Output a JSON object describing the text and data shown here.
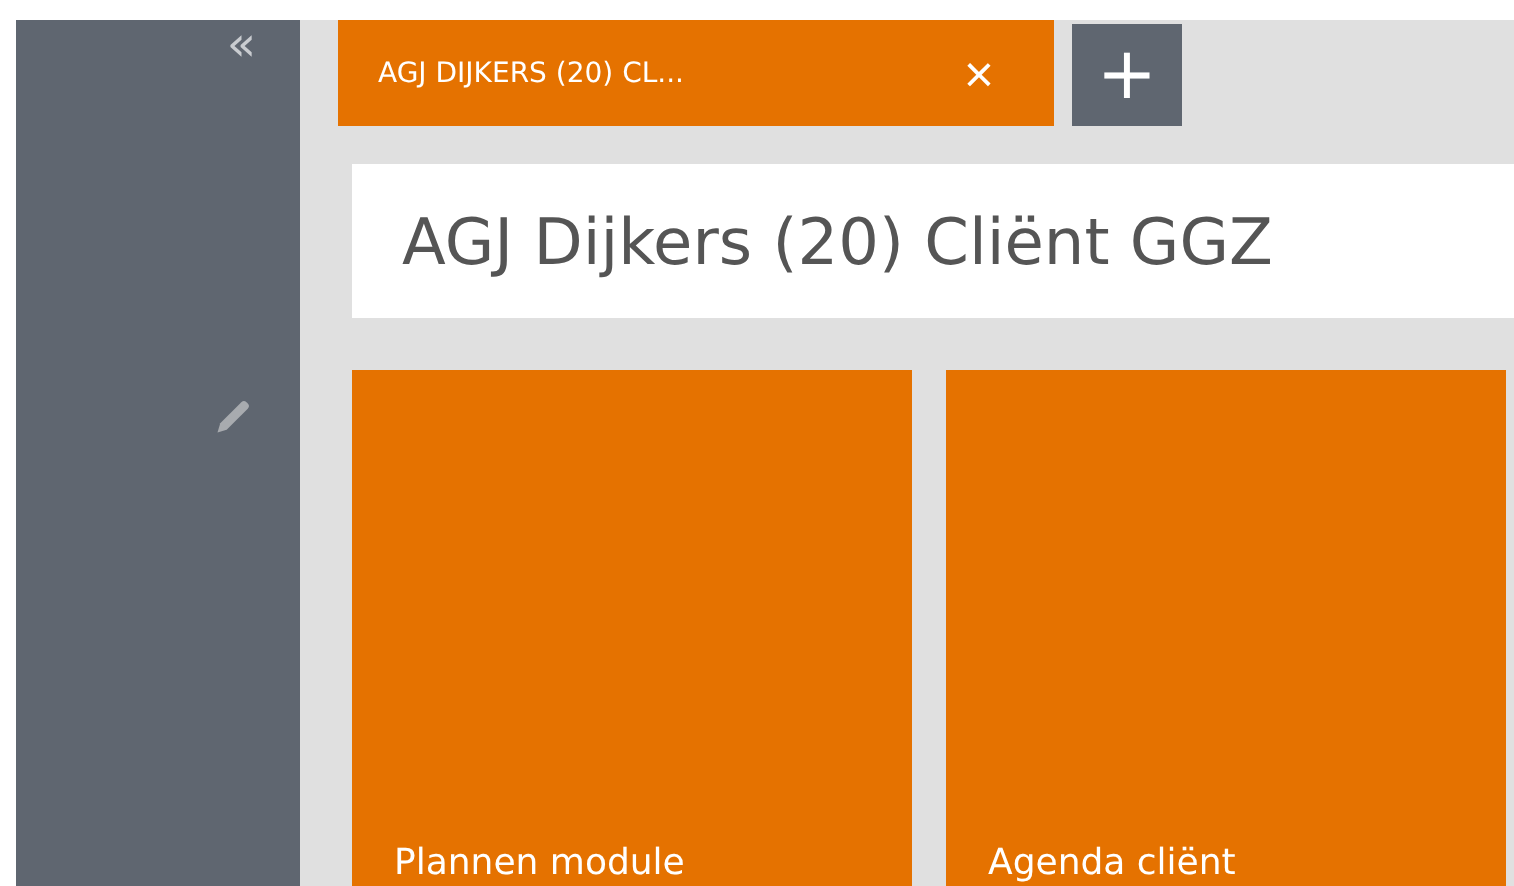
{
  "sidebar": {
    "collapse": "«"
  },
  "tabs": [
    {
      "label": "AGJ DIJKERS (20) CL...",
      "close": "×",
      "selected": true
    }
  ],
  "add_tab": "+",
  "page_title": "AGJ Dijkers (20) Cliënt GGZ",
  "tiles": [
    {
      "label": "Plannen module"
    },
    {
      "label": "Agenda cliënt"
    }
  ]
}
